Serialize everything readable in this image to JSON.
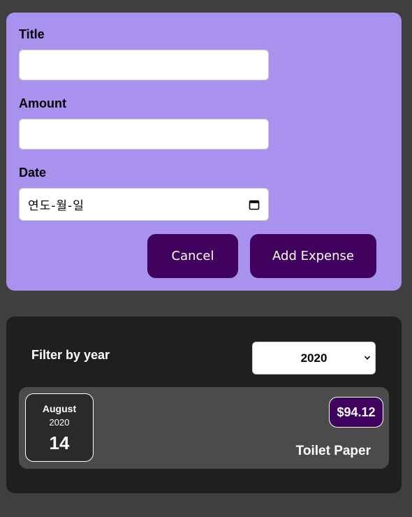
{
  "form": {
    "title_label": "Title",
    "title_value": "",
    "amount_label": "Amount",
    "amount_value": "",
    "date_label": "Date",
    "date_placeholder": "연도-월-일",
    "cancel_label": "Cancel",
    "submit_label": "Add Expense"
  },
  "filter": {
    "label": "Filter by year",
    "selected_year": "2020"
  },
  "expenses": [
    {
      "month": "August",
      "year": "2020",
      "day": "14",
      "title": "Toilet Paper",
      "amount": "$94.12"
    }
  ],
  "colors": {
    "form_bg": "#a892ee",
    "button_bg": "#40005d",
    "panel_bg": "#1f1f1f",
    "item_bg": "#4b4b4b",
    "page_bg": "#3f3f3f"
  },
  "icons": {
    "date_picker": "calendar-icon",
    "select_arrow": "chevron-down-icon"
  }
}
